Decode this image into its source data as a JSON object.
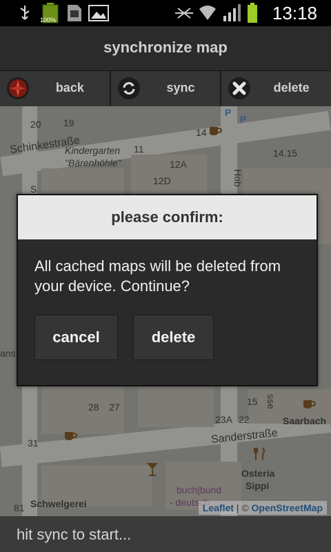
{
  "status_bar": {
    "battery_percent_label": "100%",
    "time": "13:18",
    "icons": [
      "usb-icon",
      "battery-icon",
      "sdcard-icon",
      "gallery-icon",
      "mute-icon",
      "wifi-icon",
      "signal-icon",
      "battery-icon"
    ]
  },
  "titlebar": {
    "title": "synchronize map"
  },
  "toolbar": {
    "back_label": "back",
    "sync_label": "sync",
    "delete_label": "delete"
  },
  "map": {
    "labels": {
      "street_1": "Schinkestraße",
      "poi_1": "Kindergarten",
      "poi_2": "\"Bärenhöhle\"",
      "street_2": "Sanderstraße",
      "poi_3": "Osteria",
      "poi_4": "Sippi",
      "poi_5": "Schwelgerei",
      "poi_6": "buch|bund",
      "poi_7": "- deutsch",
      "poi_8": "Saarbach",
      "num_20": "20",
      "num_19": "19",
      "num_11": "11",
      "num_12a": "12A",
      "num_12d": "12D",
      "num_14": "14",
      "num_14_15": "14.15",
      "num_28": "28",
      "num_27": "27",
      "num_23a": "23A",
      "num_22": "22",
      "num_31": "31",
      "num_15": "15",
      "num_81": "81",
      "street_hob": "Hob",
      "street_sse": "sse",
      "street_ans": "ans",
      "street_s": "S"
    },
    "attribution": {
      "leaflet": "Leaflet",
      "separator": "| ©",
      "osm": "OpenStreetMap"
    }
  },
  "dialog": {
    "title": "please confirm:",
    "message": "All cached maps will be deleted from your device. Continue?",
    "cancel_label": "cancel",
    "delete_label": "delete"
  },
  "footer": {
    "status_text": "hit sync to start..."
  },
  "colors": {
    "status_bar": "#000000",
    "title_bar": "#2b2b2b",
    "dialog_bg": "#2a2a2a",
    "dialog_title_bg": "#e8e8e8",
    "battery": "#9ccc2a"
  }
}
